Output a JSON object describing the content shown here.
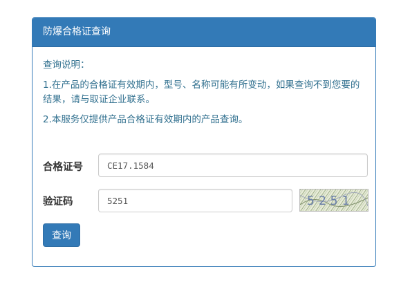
{
  "panel": {
    "title": "防爆合格证查询"
  },
  "notice": {
    "heading": "查询说明：",
    "item1": "1.在产品的合格证有效期内，型号、名称可能有所变动，如果查询不到您要的结果，请与取证企业联系。",
    "item2": "2.本服务仅提供产品合格证有效期内的产品查询。"
  },
  "form": {
    "cert_label": "合格证号",
    "cert_value": "CE17.1584",
    "code_label": "验证码",
    "code_value": "5251",
    "captcha_text": "5251",
    "submit_label": "查询"
  },
  "colors": {
    "primary": "#337ab7",
    "notice_text": "#31708f"
  }
}
